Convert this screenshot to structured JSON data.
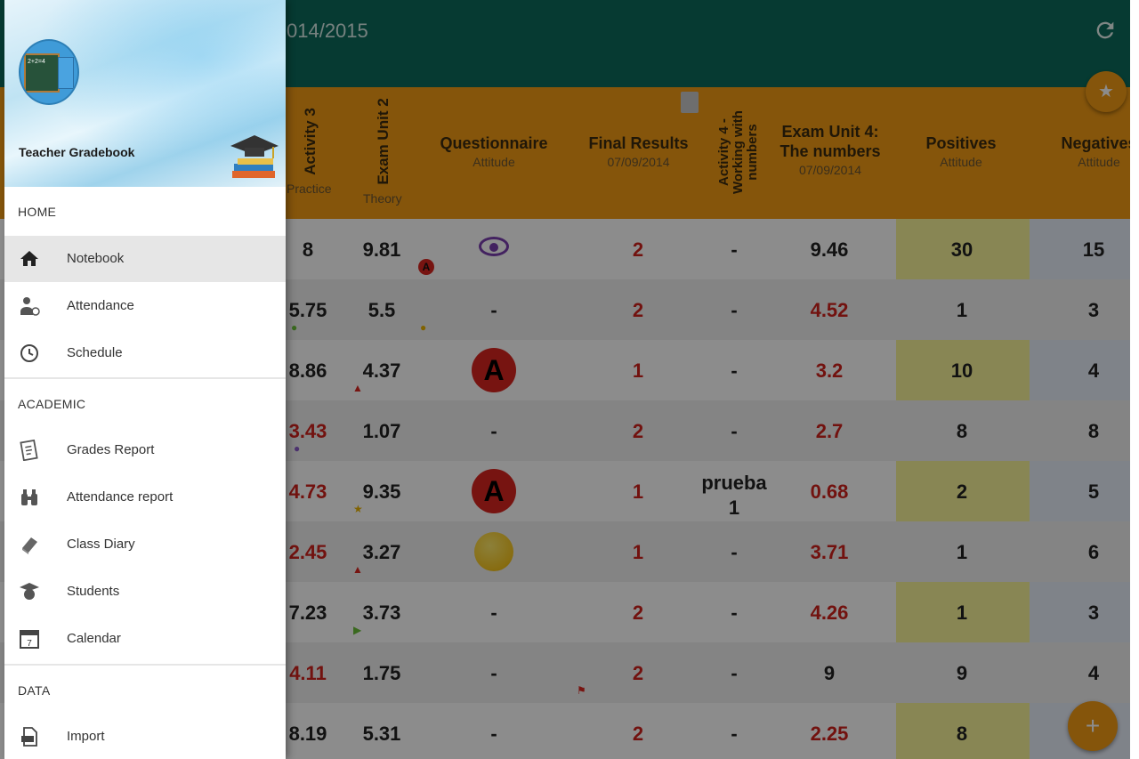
{
  "appbar": {
    "year_text": "014/2015"
  },
  "columns": {
    "activity3": {
      "title": "Activity 3",
      "sub": "Practice"
    },
    "exam2": {
      "title": "Exam Unit 2",
      "sub": "Theory"
    },
    "questionnaire": {
      "title": "Questionnaire",
      "sub": "Attitude"
    },
    "final": {
      "title": "Final Results",
      "sub": "07/09/2014"
    },
    "activity4": {
      "title": "Activity 4 - Working with numbers"
    },
    "exam4": {
      "title": "Exam Unit 4: The numbers",
      "sub": "07/09/2014"
    },
    "positives": {
      "title": "Positives",
      "sub": "Attitude"
    },
    "negatives": {
      "title": "Negatives",
      "sub": "Attitude"
    }
  },
  "rows": [
    {
      "a3": "8",
      "a3red": false,
      "e2": "9.81",
      "q": "eye",
      "fin": "2",
      "a4": "-",
      "e4": "9.46",
      "e4red": false,
      "pos": "30",
      "neg": "15"
    },
    {
      "a3": "5.75",
      "a3red": false,
      "e2": "5.5",
      "q": "-",
      "fin": "2",
      "a4": "-",
      "e4": "4.52",
      "e4red": true,
      "pos": "1",
      "neg": "3"
    },
    {
      "a3": "8.86",
      "a3red": false,
      "e2": "4.37",
      "q": "A",
      "fin": "1",
      "a4": "-",
      "e4": "3.2",
      "e4red": true,
      "pos": "10",
      "neg": "4"
    },
    {
      "a3": "3.43",
      "a3red": true,
      "e2": "1.07",
      "q": "-",
      "fin": "2",
      "a4": "-",
      "e4": "2.7",
      "e4red": true,
      "pos": "8",
      "neg": "8"
    },
    {
      "a3": "4.73",
      "a3red": true,
      "e2": "9.35",
      "q": "A",
      "fin": "1",
      "a4": "prueba",
      "a4b": "1",
      "e4": "0.68",
      "e4red": true,
      "pos": "2",
      "neg": "5"
    },
    {
      "a3": "2.45",
      "a3red": true,
      "e2": "3.27",
      "q": "smiley",
      "fin": "1",
      "a4": "-",
      "e4": "3.71",
      "e4red": true,
      "pos": "1",
      "neg": "6"
    },
    {
      "a3": "7.23",
      "a3red": false,
      "e2": "3.73",
      "q": "-",
      "fin": "2",
      "a4": "-",
      "e4": "4.26",
      "e4red": true,
      "pos": "1",
      "neg": "3"
    },
    {
      "a3": "4.11",
      "a3red": true,
      "e2": "1.75",
      "q": "-",
      "fin": "2",
      "a4": "-",
      "e4": "9",
      "e4red": false,
      "pos": "9",
      "neg": "4"
    },
    {
      "a3": "8.19",
      "a3red": false,
      "e2": "5.31",
      "q": "-",
      "fin": "2",
      "a4": "-",
      "e4": "2.25",
      "e4red": true,
      "pos": "8",
      "neg": ""
    }
  ],
  "small_a": "A",
  "fab_add": "+",
  "fab_star": "★",
  "drawer": {
    "app_name": "Teacher Gradebook",
    "avatar_board_text": "2+2=4",
    "sections": {
      "home": "HOME",
      "academic": "ACADEMIC",
      "data": "DATA"
    },
    "items": {
      "notebook": "Notebook",
      "attendance": "Attendance",
      "schedule": "Schedule",
      "grades_report": "Grades Report",
      "attendance_report": "Attendance report",
      "class_diary": "Class Diary",
      "students": "Students",
      "calendar": "Calendar",
      "calendar_day": "7",
      "import": "Import"
    }
  },
  "colors": {
    "appbar": "#0b6b5b",
    "header_row": "#f29b15",
    "accent": "#f29b15",
    "fail": "#d0221c"
  }
}
